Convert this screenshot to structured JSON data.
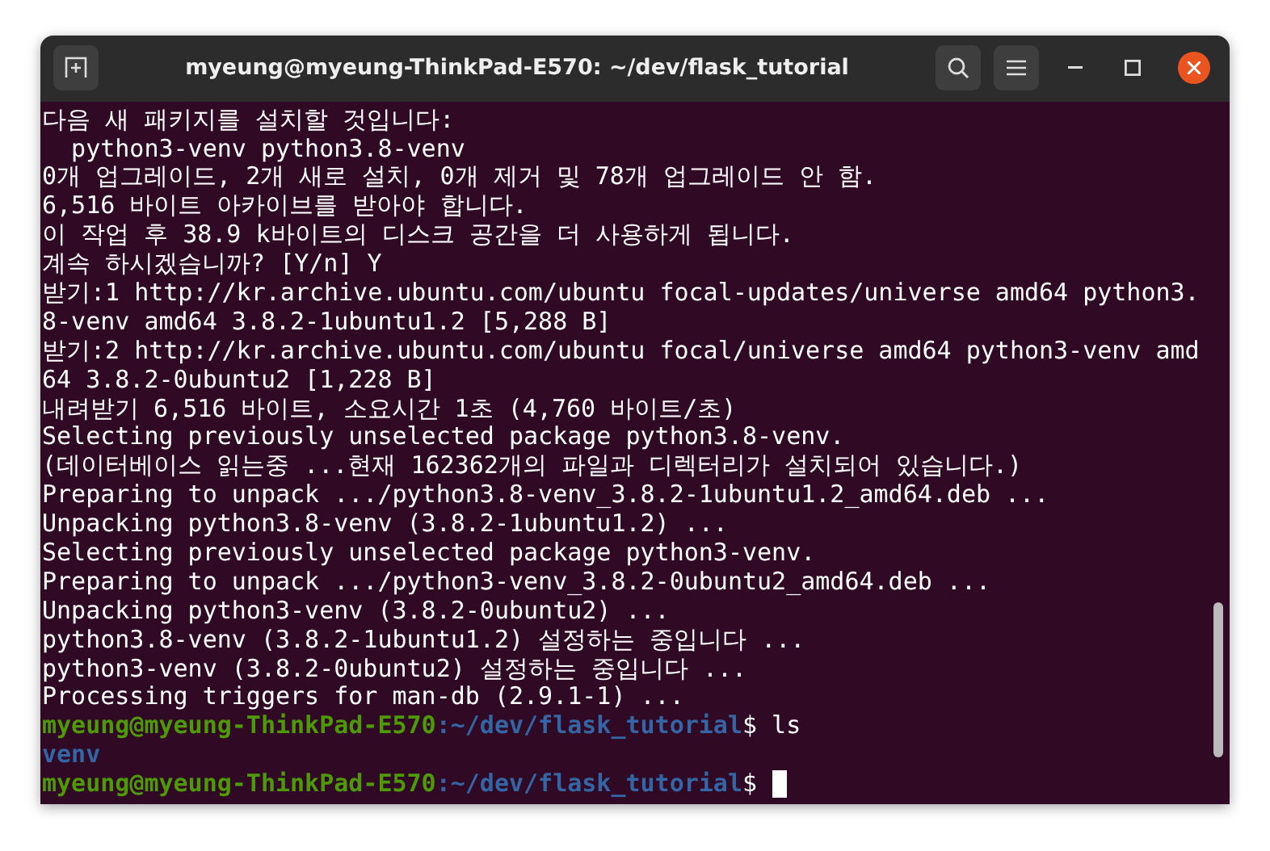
{
  "window": {
    "title": "myeung@myeung-ThinkPad-E570: ~/dev/flask_tutorial"
  },
  "terminal": {
    "lines": [
      {
        "kind": "output",
        "text": "다음 새 패키지를 설치할 것입니다:"
      },
      {
        "kind": "output",
        "text": "  python3-venv python3.8-venv"
      },
      {
        "kind": "output",
        "text": "0개 업그레이드, 2개 새로 설치, 0개 제거 및 78개 업그레이드 안 함."
      },
      {
        "kind": "output",
        "text": "6,516 바이트 아카이브를 받아야 합니다."
      },
      {
        "kind": "output",
        "text": "이 작업 후 38.9 k바이트의 디스크 공간을 더 사용하게 됩니다."
      },
      {
        "kind": "output",
        "text": "계속 하시겠습니까? [Y/n] Y"
      },
      {
        "kind": "output",
        "text": "받기:1 http://kr.archive.ubuntu.com/ubuntu focal-updates/universe amd64 python3."
      },
      {
        "kind": "output",
        "text": "8-venv amd64 3.8.2-1ubuntu1.2 [5,288 B]"
      },
      {
        "kind": "output",
        "text": "받기:2 http://kr.archive.ubuntu.com/ubuntu focal/universe amd64 python3-venv amd"
      },
      {
        "kind": "output",
        "text": "64 3.8.2-0ubuntu2 [1,228 B]"
      },
      {
        "kind": "output",
        "text": "내려받기 6,516 바이트, 소요시간 1초 (4,760 바이트/초)"
      },
      {
        "kind": "output",
        "text": "Selecting previously unselected package python3.8-venv."
      },
      {
        "kind": "output",
        "text": "(데이터베이스 읽는중 ...현재 162362개의 파일과 디렉터리가 설치되어 있습니다.)"
      },
      {
        "kind": "output",
        "text": "Preparing to unpack .../python3.8-venv_3.8.2-1ubuntu1.2_amd64.deb ..."
      },
      {
        "kind": "output",
        "text": "Unpacking python3.8-venv (3.8.2-1ubuntu1.2) ..."
      },
      {
        "kind": "output",
        "text": "Selecting previously unselected package python3-venv."
      },
      {
        "kind": "output",
        "text": "Preparing to unpack .../python3-venv_3.8.2-0ubuntu2_amd64.deb ..."
      },
      {
        "kind": "output",
        "text": "Unpacking python3-venv (3.8.2-0ubuntu2) ..."
      },
      {
        "kind": "output",
        "text": "python3.8-venv (3.8.2-1ubuntu1.2) 설정하는 중입니다 ..."
      },
      {
        "kind": "output",
        "text": "python3-venv (3.8.2-0ubuntu2) 설정하는 중입니다 ..."
      },
      {
        "kind": "output",
        "text": "Processing triggers for man-db (2.9.1-1) ..."
      },
      {
        "kind": "prompt",
        "user": "myeung@myeung-ThinkPad-E570",
        "path": ":~/dev/flask_tutorial",
        "sign": "$",
        "command": " ls",
        "cursor": false
      },
      {
        "kind": "dir",
        "text": "venv"
      },
      {
        "kind": "prompt",
        "user": "myeung@myeung-ThinkPad-E570",
        "path": ":~/dev/flask_tutorial",
        "sign": "$",
        "cursor": true
      }
    ]
  }
}
